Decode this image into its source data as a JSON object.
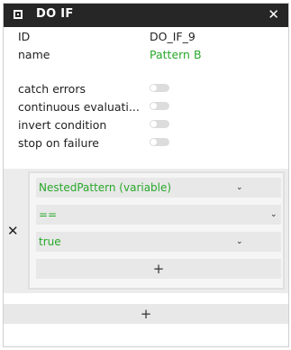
{
  "header": {
    "title": "DO IF",
    "close_glyph": "✕",
    "icon": "block-square-icon"
  },
  "properties": {
    "id_label": "ID",
    "id_value": "DO_IF_9",
    "name_label": "name",
    "name_value": "Pattern B"
  },
  "toggles": [
    {
      "label": "catch errors",
      "on": false
    },
    {
      "label": "continuous evaluati...",
      "on": false
    },
    {
      "label": "invert condition",
      "on": false
    },
    {
      "label": "stop on failure",
      "on": false
    }
  ],
  "condition": {
    "remove_glyph": "✕",
    "left_operand": "NestedPattern (variable)",
    "operator": "==",
    "right_operand": "true",
    "add_glyph": "+"
  },
  "footer": {
    "add_glyph": "+"
  },
  "colors": {
    "header_bg": "#262626",
    "accent_green": "#29a82b",
    "field_bg": "#e8e8e8"
  }
}
